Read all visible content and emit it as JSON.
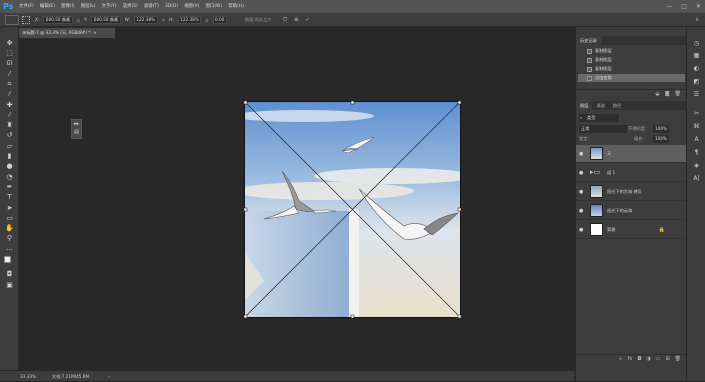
{
  "app": {
    "logo": "Ps"
  },
  "menu": [
    "文件(F)",
    "编辑(E)",
    "图像(I)",
    "图层(L)",
    "文字(Y)",
    "选择(S)",
    "滤镜(T)",
    "3D(D)",
    "视图(V)",
    "窗口(W)",
    "帮助(H)"
  ],
  "window_controls": [
    "—",
    "□",
    "✕"
  ],
  "options": {
    "x_label": "X:",
    "x_value": "600.50 像素",
    "y_label": "Y:",
    "y_value": "600.50 像素",
    "w_label": "W:",
    "w_value": "122.38%",
    "h_label": "H:",
    "h_value": "122.38%",
    "angle_label": "△",
    "angle_value": "0.00",
    "interp": "插值:两次立方",
    "warp": "变形",
    "cancel": "⊘",
    "commit": "✓"
  },
  "document_tab": {
    "title": "未标题-1 @ 33.3% (天, RGB/8#) *",
    "close": "×"
  },
  "status": {
    "zoom": "33.33%",
    "doc": "文档:7.21M/45.8M",
    "arrow": "›"
  },
  "history": {
    "tabs": [
      "历史记录"
    ],
    "items": [
      "复制图层",
      "复制图层",
      "复制图层",
      "自由变换"
    ],
    "selected_index": 3
  },
  "layers": {
    "tabs": [
      "图层",
      "通道",
      "路径"
    ],
    "search_placeholder": "类型",
    "blend_mode": "正常",
    "opacity_label": "不透明度:",
    "opacity_value": "100%",
    "lock_label": "锁定:",
    "fill_label": "填充:",
    "fill_value": "100%",
    "rows": [
      {
        "name": "天",
        "selected": true,
        "thumb": "sky"
      },
      {
        "name": "组 1",
        "selected": false,
        "thumb": "folder"
      },
      {
        "name": "阳光下的大海 拷贝",
        "selected": false,
        "thumb": "sea"
      },
      {
        "name": "阳光下的云海",
        "selected": false,
        "thumb": "bird"
      },
      {
        "name": "背景",
        "selected": false,
        "thumb": "white",
        "locked": "🔒"
      }
    ],
    "footer_icons": [
      "link-icon",
      "fx-icon",
      "mask-icon",
      "adjust-icon",
      "folder-icon",
      "new-layer-icon",
      "trash-icon"
    ]
  },
  "colors": {
    "accent": "#31a8ff",
    "panel": "#3d3d3d",
    "canvas": "#282828"
  }
}
